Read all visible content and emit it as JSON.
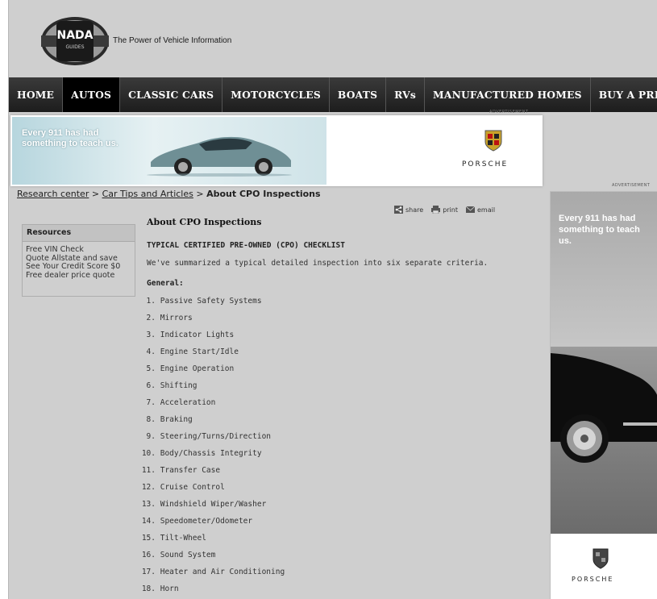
{
  "header": {
    "logo_text_top": "NADA",
    "logo_text_bottom": "GUIDES",
    "tagline": "The Power of Vehicle Information"
  },
  "nav": {
    "items": [
      {
        "label": "HOME",
        "active": false
      },
      {
        "label": "AUTOS",
        "active": true
      },
      {
        "label": "CLASSIC CARS",
        "active": false
      },
      {
        "label": "MOTORCYCLES",
        "active": false
      },
      {
        "label": "BOATS",
        "active": false
      },
      {
        "label": "RVs",
        "active": false
      },
      {
        "label": "MANUFACTURED HOMES",
        "active": false
      },
      {
        "label": "BUY A PRICE GUIDE",
        "active": false
      }
    ]
  },
  "top_ad": {
    "label": "ADVERTISEMENT",
    "text": "Every 911 has had something to teach us.",
    "brand": "PORSCHE"
  },
  "breadcrumb": {
    "link1": "Research center",
    "sep": ">",
    "link2": "Car Tips and Articles",
    "current": "About CPO Inspections"
  },
  "tools": {
    "share": "share",
    "print": "print",
    "email": "email"
  },
  "resources": {
    "title": "Resources",
    "items": [
      "Free VIN Check",
      "Quote Allstate and save",
      "See Your Credit Score $0",
      "Free dealer price quote"
    ]
  },
  "article": {
    "title": "About CPO Inspections",
    "subtitle": "TYPICAL CERTIFIED PRE-OWNED (CPO) CHECKLIST",
    "intro": "We've summarized a typical detailed inspection into six separate criteria.",
    "section": "General:",
    "items": [
      {
        "num": "1.",
        "text": "Passive Safety Systems"
      },
      {
        "num": "2.",
        "text": "Mirrors"
      },
      {
        "num": "3.",
        "text": "Indicator Lights"
      },
      {
        "num": "4.",
        "text": "Engine Start/Idle"
      },
      {
        "num": "5.",
        "text": "Engine Operation"
      },
      {
        "num": "6.",
        "text": "Shifting"
      },
      {
        "num": "7.",
        "text": "Acceleration"
      },
      {
        "num": "8.",
        "text": "Braking"
      },
      {
        "num": "9.",
        "text": "Steering/Turns/Direction"
      },
      {
        "num": "10.",
        "text": "Body/Chassis Integrity"
      },
      {
        "num": "11.",
        "text": "Transfer Case"
      },
      {
        "num": "12.",
        "text": "Cruise Control"
      },
      {
        "num": "13.",
        "text": "Windshield Wiper/Washer"
      },
      {
        "num": "14.",
        "text": "Speedometer/Odometer"
      },
      {
        "num": "15.",
        "text": "Tilt-Wheel"
      },
      {
        "num": "16.",
        "text": "Sound System"
      },
      {
        "num": "17.",
        "text": "Heater and Air Conditioning"
      },
      {
        "num": "18.",
        "text": "Horn"
      }
    ]
  },
  "side_ad": {
    "label": "ADVERTISEMENT",
    "text": "Every 911 has had something to teach us.",
    "brand": "PORSCHE"
  },
  "icons": [
    "nada-logo",
    "share-icon",
    "print-icon",
    "email-icon",
    "porsche-crest-icon"
  ]
}
